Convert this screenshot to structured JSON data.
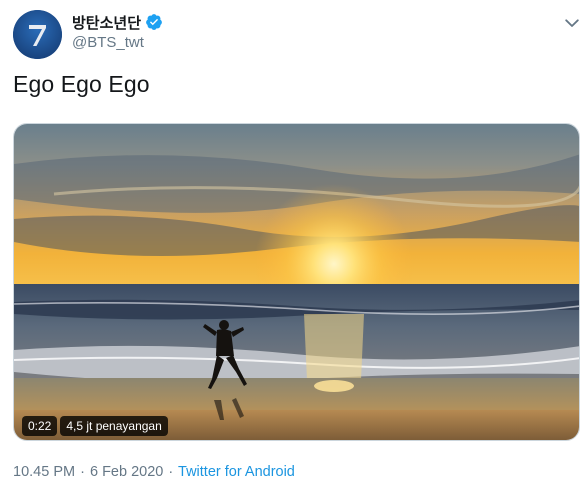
{
  "author": {
    "display_name": "방탄소년단",
    "handle": "@BTS_twt",
    "verified": true,
    "avatar_glyph": "7"
  },
  "tweet": {
    "text": "Ego Ego Ego"
  },
  "video": {
    "duration": "0:22",
    "views": "4,5 jt penayangan"
  },
  "meta": {
    "time": "10.45 PM",
    "separator": "·",
    "date": "6 Feb 2020",
    "separator2": "·",
    "source": "Twitter for Android"
  },
  "colors": {
    "link": "#1b95e0",
    "secondary_text": "#657786",
    "verified": "#1da1f2",
    "avatar_bg": "#1d4f8f"
  },
  "icons": {
    "verified": "verified-badge-icon",
    "more": "chevron-down-icon"
  }
}
